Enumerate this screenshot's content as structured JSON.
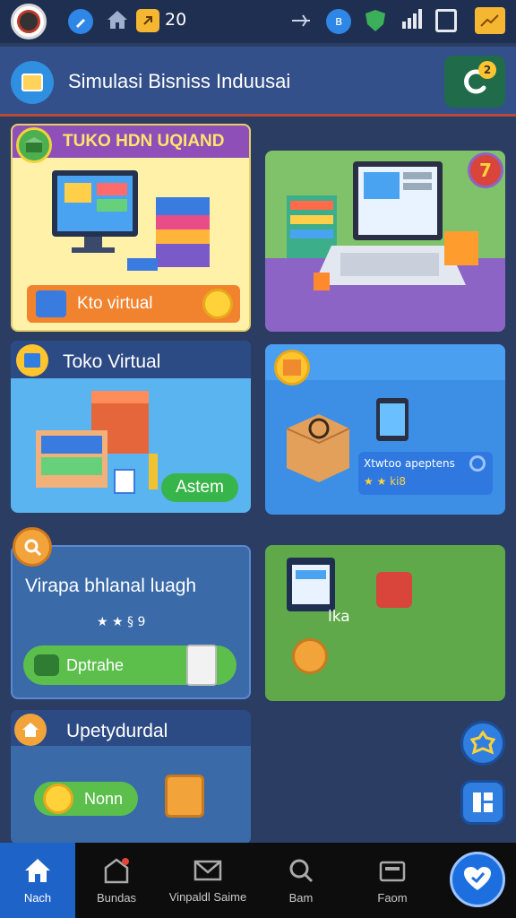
{
  "status_bar": {
    "count": "20",
    "icons": [
      "avatar-icon",
      "edit-icon",
      "home-icon",
      "coin-icon",
      "airplane-icon",
      "bluetooth-icon",
      "shield-icon",
      "signal-icon",
      "battery-icon",
      "chart-icon"
    ]
  },
  "header": {
    "title": "Simulasi Bisniss Induusai",
    "action_badge": "2",
    "icons": [
      "app-logo-icon",
      "chat-icon"
    ]
  },
  "cards": {
    "card1": {
      "title": "TUKO HDN UQIAND",
      "button_label": "Kto virtual",
      "colors": {
        "bg": "#fff2a8",
        "title_bar": "#8e4fb8",
        "button": "#f2832e"
      }
    },
    "card2": {
      "badge": "7",
      "colors": {
        "bg": "#7fc26a",
        "accent": "#8c64c6"
      }
    },
    "card3": {
      "title": "Toko Virtual",
      "button_label": "Astem",
      "colors": {
        "bg": "#59b4f0",
        "header": "#2c4a84",
        "button": "#37b54a"
      }
    },
    "card4": {
      "info_text": "Xtwtoo apeptens",
      "info_sub": "★ ★ ki8",
      "colors": {
        "bg": "#3d8fe5"
      }
    },
    "card5": {
      "title": "Virapa bhlanal luagh",
      "rating": "★ ★ § 9",
      "button_label": "Dptrahe",
      "colors": {
        "bg": "#3a6aa8",
        "button": "#5cbf4c"
      }
    },
    "card6": {
      "label": "lka",
      "colors": {
        "bg": "#5fa94a"
      }
    },
    "card7": {
      "title": "Upetydurdal",
      "button_label": "Nonn",
      "colors": {
        "bg": "#3a6aa8",
        "button": "#5cbf4c"
      }
    }
  },
  "fabs": [
    "settings-badge-icon",
    "dashboard-icon"
  ],
  "bottom_nav": {
    "items": [
      {
        "label": "Nach",
        "icon": "home-icon",
        "active": true
      },
      {
        "label": "Bundas",
        "icon": "store-icon",
        "active": false
      },
      {
        "label": "Vinpaldl Saime",
        "icon": "mail-icon",
        "active": false
      },
      {
        "label": "Bam",
        "icon": "search-icon",
        "active": false
      },
      {
        "label": "Faom",
        "icon": "wallet-icon",
        "active": false
      }
    ],
    "fab_icon": "heart-chat-icon"
  },
  "accent_color": "#1e63c8"
}
